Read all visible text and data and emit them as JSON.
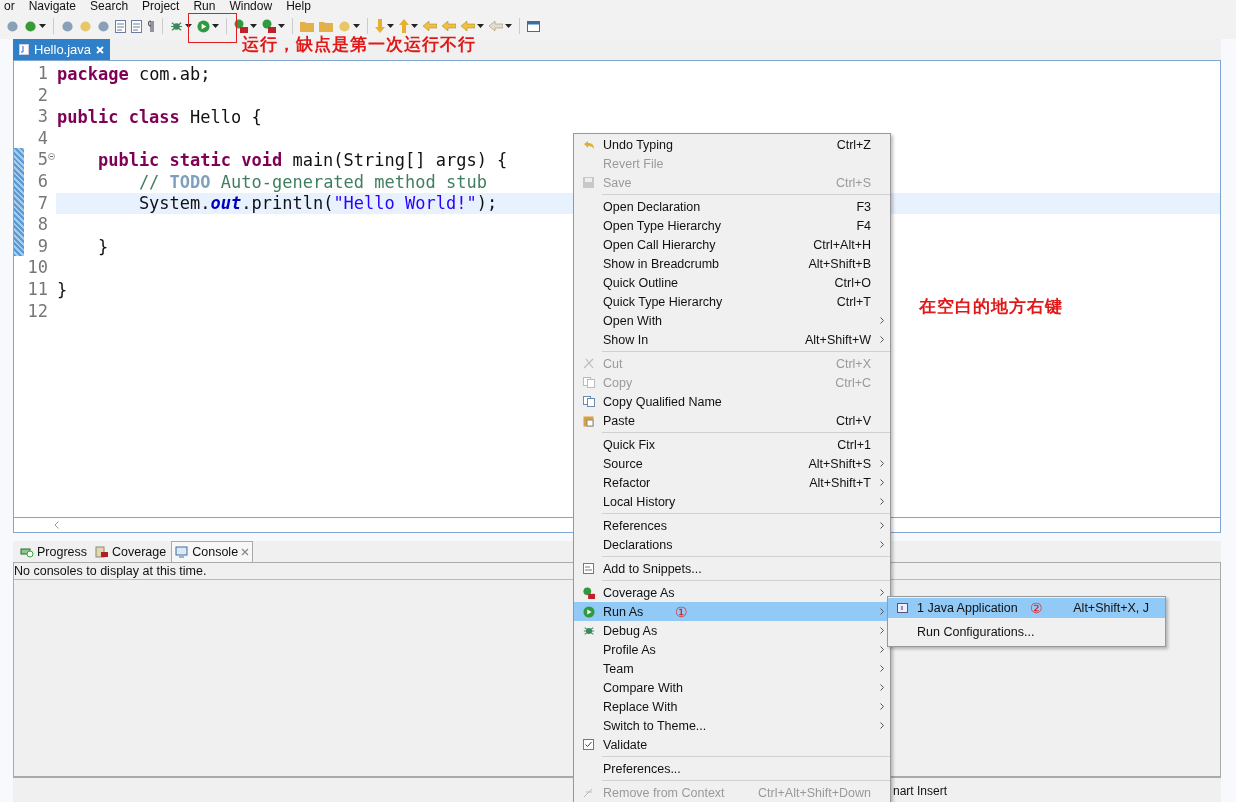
{
  "menu_bar": [
    "or",
    "Navigate",
    "Search",
    "Project",
    "Run",
    "Window",
    "Help"
  ],
  "editor_tab": {
    "label": "Hello.java",
    "selected": true
  },
  "code_lines": [
    {
      "number": "1",
      "selected": false,
      "foldable": false,
      "tokens": [
        {
          "kind": "keyword",
          "text": "package"
        },
        {
          "kind": "plain",
          "text": " com.ab;"
        }
      ]
    },
    {
      "number": "2",
      "selected": false,
      "foldable": false
    },
    {
      "number": "3",
      "selected": false,
      "foldable": false,
      "tokens": [
        {
          "kind": "keyword",
          "text": "public class"
        },
        {
          "kind": "plain",
          "text": " Hello {"
        }
      ]
    },
    {
      "number": "4",
      "selected": false,
      "foldable": false
    },
    {
      "number": "5",
      "selected": false,
      "foldable": true,
      "tokens": [
        {
          "kind": "keyword",
          "text": "    public static void"
        },
        {
          "kind": "plain",
          "text": " main(String[] args) {"
        }
      ]
    },
    {
      "number": "6",
      "selected": false,
      "foldable": false,
      "tokens": [
        {
          "kind": "comment",
          "text": "        // "
        },
        {
          "kind": "todo",
          "text": "TODO"
        },
        {
          "kind": "comment",
          "text": " Auto-generated method stub"
        }
      ]
    },
    {
      "number": "7",
      "selected": true,
      "foldable": false,
      "tokens": [
        {
          "kind": "plain",
          "text": "        System."
        },
        {
          "kind": "field",
          "text": "out"
        },
        {
          "kind": "plain",
          "text": ".println("
        },
        {
          "kind": "string",
          "text": "\"Hello World!\""
        },
        {
          "kind": "plain",
          "text": ");"
        }
      ]
    },
    {
      "number": "8",
      "selected": false,
      "foldable": false
    },
    {
      "number": "9",
      "selected": false,
      "foldable": false,
      "tokens": [
        {
          "kind": "plain",
          "text": "    }"
        }
      ]
    },
    {
      "number": "10",
      "selected": false,
      "foldable": false
    },
    {
      "number": "11",
      "selected": false,
      "foldable": false,
      "tokens": [
        {
          "kind": "plain",
          "text": "}"
        }
      ]
    },
    {
      "number": "12",
      "selected": false,
      "foldable": false
    }
  ],
  "bottom_tabs": [
    {
      "label": "Progress",
      "selected": false
    },
    {
      "label": "Coverage",
      "selected": false
    },
    {
      "label": "Console",
      "selected": true
    }
  ],
  "console_message": "No consoles to display at this time.",
  "status_bar": {
    "insert_mode": "nart Insert"
  },
  "context_menu": [
    [
      {
        "label": "Undo Typing",
        "shortcut": "Ctrl+Z",
        "disabled": false,
        "submenu": false,
        "selected": false
      },
      {
        "label": "Revert File",
        "disabled": true,
        "submenu": false,
        "selected": false
      },
      {
        "label": "Save",
        "shortcut": "Ctrl+S",
        "disabled": true,
        "submenu": false,
        "selected": false
      }
    ],
    [
      {
        "label": "Open Declaration",
        "shortcut": "F3",
        "disabled": false,
        "submenu": false,
        "selected": false
      },
      {
        "label": "Open Type Hierarchy",
        "shortcut": "F4",
        "disabled": false,
        "submenu": false,
        "selected": false
      },
      {
        "label": "Open Call Hierarchy",
        "shortcut": "Ctrl+Alt+H",
        "disabled": false,
        "submenu": false,
        "selected": false
      },
      {
        "label": "Show in Breadcrumb",
        "shortcut": "Alt+Shift+B",
        "disabled": false,
        "submenu": false,
        "selected": false
      },
      {
        "label": "Quick Outline",
        "shortcut": "Ctrl+O",
        "disabled": false,
        "submenu": false,
        "selected": false
      },
      {
        "label": "Quick Type Hierarchy",
        "shortcut": "Ctrl+T",
        "disabled": false,
        "submenu": false,
        "selected": false
      },
      {
        "label": "Open With",
        "disabled": false,
        "submenu": true,
        "selected": false
      },
      {
        "label": "Show In",
        "shortcut": "Alt+Shift+W",
        "disabled": false,
        "submenu": true,
        "selected": false
      }
    ],
    [
      {
        "label": "Cut",
        "shortcut": "Ctrl+X",
        "disabled": true,
        "submenu": false,
        "selected": false
      },
      {
        "label": "Copy",
        "shortcut": "Ctrl+C",
        "disabled": true,
        "submenu": false,
        "selected": false
      },
      {
        "label": "Copy Qualified Name",
        "disabled": false,
        "submenu": false,
        "selected": false
      },
      {
        "label": "Paste",
        "shortcut": "Ctrl+V",
        "disabled": false,
        "submenu": false,
        "selected": false
      }
    ],
    [
      {
        "label": "Quick Fix",
        "shortcut": "Ctrl+1",
        "disabled": false,
        "submenu": false,
        "selected": false
      },
      {
        "label": "Source",
        "shortcut": "Alt+Shift+S",
        "disabled": false,
        "submenu": true,
        "selected": false
      },
      {
        "label": "Refactor",
        "shortcut": "Alt+Shift+T",
        "disabled": false,
        "submenu": true,
        "selected": false
      },
      {
        "label": "Local History",
        "disabled": false,
        "submenu": true,
        "selected": false
      }
    ],
    [
      {
        "label": "References",
        "disabled": false,
        "submenu": true,
        "selected": false
      },
      {
        "label": "Declarations",
        "disabled": false,
        "submenu": true,
        "selected": false
      }
    ],
    [
      {
        "label": "Add to Snippets...",
        "disabled": false,
        "submenu": false,
        "selected": false
      }
    ],
    [
      {
        "label": "Coverage As",
        "disabled": false,
        "submenu": true,
        "selected": false
      },
      {
        "label": "Run As",
        "note": "①",
        "disabled": false,
        "submenu": true,
        "selected": true
      },
      {
        "label": "Debug As",
        "disabled": false,
        "submenu": true,
        "selected": false
      },
      {
        "label": "Profile As",
        "disabled": false,
        "submenu": true,
        "selected": false
      },
      {
        "label": "Team",
        "disabled": false,
        "submenu": true,
        "selected": false
      },
      {
        "label": "Compare With",
        "disabled": false,
        "submenu": true,
        "selected": false
      },
      {
        "label": "Replace With",
        "disabled": false,
        "submenu": true,
        "selected": false
      },
      {
        "label": "Switch to Theme...",
        "disabled": false,
        "submenu": true,
        "selected": false
      },
      {
        "label": "Validate",
        "disabled": false,
        "submenu": false,
        "selected": false
      }
    ],
    [
      {
        "label": "Preferences...",
        "disabled": false,
        "submenu": false,
        "selected": false
      }
    ],
    [
      {
        "label": "Remove from Context",
        "shortcut": "Ctrl+Alt+Shift+Down",
        "disabled": true,
        "submenu": false,
        "selected": false
      }
    ]
  ],
  "submenu": [
    {
      "label": "1 Java Application",
      "note": "②",
      "shortcut": "Alt+Shift+X, J",
      "selected": true
    },
    {
      "label": "Run Configurations...",
      "selected": false
    }
  ],
  "annotations": [
    {
      "text": "运行，缺点是第一次运行不行"
    },
    {
      "text": "在空白的地方右键"
    }
  ]
}
